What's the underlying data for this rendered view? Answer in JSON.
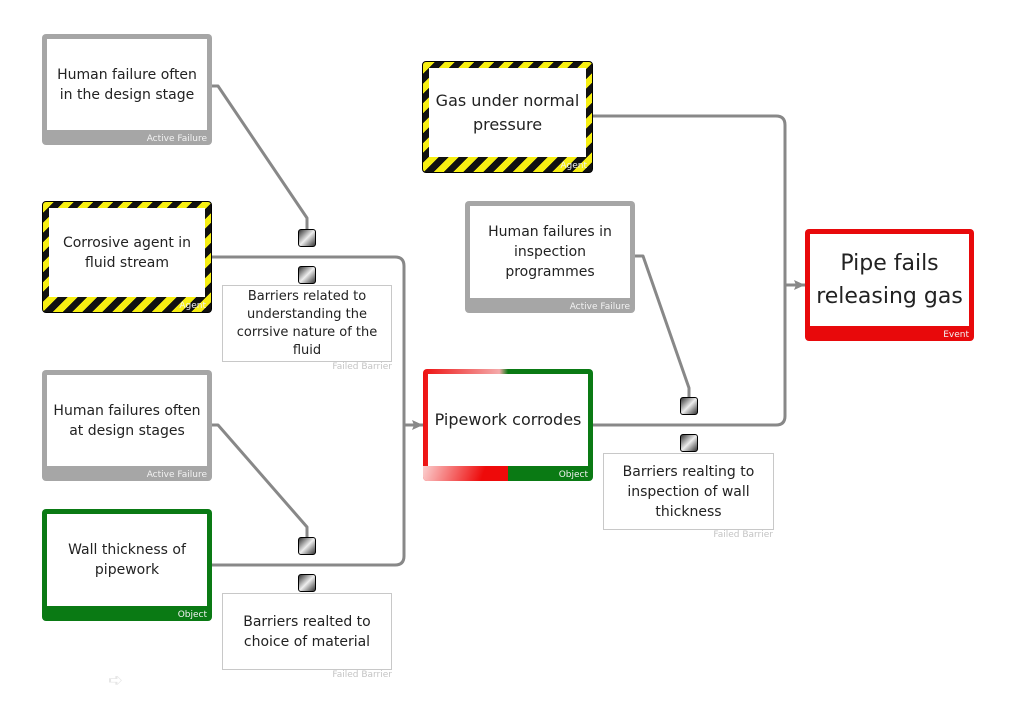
{
  "nodes": {
    "hf_design": {
      "text": "Human failure often in the design stage",
      "kind": "Active Failure"
    },
    "corrosive": {
      "text": "Corrosive agent in fluid stream",
      "kind": "Agent"
    },
    "hf_design2": {
      "text": "Human failures often at design stages",
      "kind": "Active Failure"
    },
    "wall": {
      "text": "Wall thickness of pipework",
      "kind": "Object"
    },
    "gas": {
      "text": "Gas under normal pressure",
      "kind": "Agent"
    },
    "hf_inspection": {
      "text": "Human failures in inspection programmes",
      "kind": "Active Failure"
    },
    "pipework": {
      "text": "Pipework corrodes",
      "kind": "Object"
    },
    "pipe_fails": {
      "text": "Pipe fails releasing gas",
      "kind": "Event"
    }
  },
  "barriers": {
    "fluid": {
      "text": "Barriers related to understanding the corrsive nature of the fluid",
      "kind": "Failed Barrier"
    },
    "inspection": {
      "text": "Barriers realting to inspection of wall thickness",
      "kind": "Failed Barrier"
    },
    "material": {
      "text": "Barriers realted to choice of material",
      "kind": "Failed Barrier"
    }
  },
  "colors": {
    "connector": "#888888",
    "active_failure": "#a6a6a6",
    "object": "#0a7a14",
    "event": "#e8090b",
    "hazard_black": "#111111",
    "hazard_yellow": "#f7ef12"
  },
  "icons": {
    "nav": "arrow-right-icon"
  }
}
